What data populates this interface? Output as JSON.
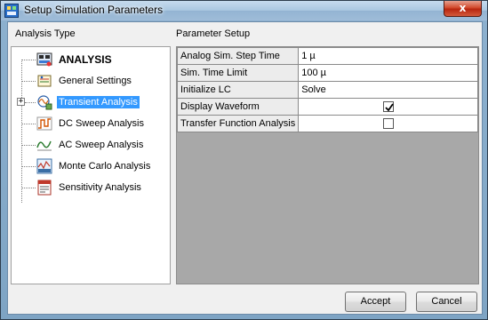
{
  "window": {
    "title": "Setup Simulation Parameters",
    "close_label": "x"
  },
  "left_group": {
    "label": "Analysis Type"
  },
  "right_group": {
    "label": "Parameter Setup"
  },
  "tree": {
    "root": {
      "label": "ANALYSIS",
      "icon": "analysis-icon"
    },
    "items": [
      {
        "label": "General Settings",
        "icon": "general-settings-icon"
      },
      {
        "label": "Transient Analysis",
        "icon": "transient-icon",
        "selected": true,
        "expander": "+"
      },
      {
        "label": "DC Sweep Analysis",
        "icon": "dc-sweep-icon"
      },
      {
        "label": "AC Sweep Analysis",
        "icon": "ac-sweep-icon"
      },
      {
        "label": "Monte Carlo Analysis",
        "icon": "monte-carlo-icon"
      },
      {
        "label": "Sensitivity Analysis",
        "icon": "sensitivity-icon"
      }
    ]
  },
  "params": [
    {
      "name": "Analog Sim. Step Time",
      "value": "1 µ"
    },
    {
      "name": "Sim. Time Limit",
      "value": "100 µ"
    },
    {
      "name": "Initialize LC",
      "value": "Solve"
    },
    {
      "name": "Display Waveform",
      "checked": true
    },
    {
      "name": "Transfer Function Analysis",
      "checked": false
    }
  ],
  "buttons": {
    "accept": "Accept",
    "cancel": "Cancel"
  },
  "colors": {
    "selection": "#3399ff",
    "close_button": "#c8391b",
    "grid_background": "#a8a8a8"
  }
}
